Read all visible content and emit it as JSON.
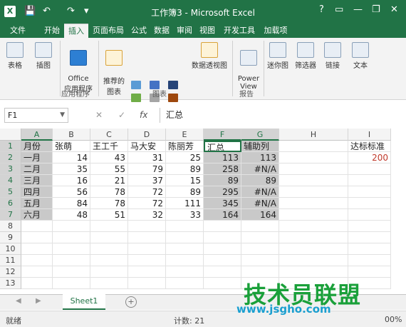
{
  "window": {
    "title": "工作簿3 - Microsoft Excel",
    "help": "?",
    "minimize": "—",
    "restore": "❐",
    "close": "✕",
    "ribbon_opts": "▭"
  },
  "quick_access": {
    "save": "💾",
    "undo": "↶",
    "redo": "↷",
    "customize": "▾"
  },
  "tabs": {
    "file": "文件",
    "items": [
      "开始",
      "插入",
      "页面布局",
      "公式",
      "数据",
      "审阅",
      "视图",
      "开发工具",
      "加载项"
    ],
    "active": "插入"
  },
  "ribbon": {
    "buttons": {
      "table": "表格",
      "illustrations": "插图",
      "office_apps": "Office\n应用程序",
      "recommended_charts": "推荐的\n图表",
      "pivot_chart": "数据透视图",
      "power_view": "Power\nView",
      "sparklines": "迷你图",
      "filter": "筛选器",
      "links": "链接",
      "text": "文本"
    },
    "groups": {
      "apps": "应用程序",
      "charts": "图表",
      "reports": "报告"
    }
  },
  "formula_bar": {
    "name_box": "F1",
    "value": "汇总",
    "cancel": "✕",
    "enter": "✓",
    "fx": "fx"
  },
  "grid": {
    "columns": [
      "A",
      "B",
      "C",
      "D",
      "E",
      "F",
      "G",
      "H",
      "I"
    ],
    "rows": [
      "1",
      "2",
      "3",
      "4",
      "5",
      "6",
      "7",
      "8",
      "9",
      "10",
      "11",
      "12",
      "13"
    ],
    "data": [
      [
        "月份",
        "张萌",
        "王工千",
        "马大安",
        "陈丽芳",
        "汇总",
        "辅助列",
        "",
        "达标标准"
      ],
      [
        "一月",
        "14",
        "43",
        "31",
        "25",
        "113",
        "113",
        "",
        "200"
      ],
      [
        "二月",
        "35",
        "55",
        "79",
        "89",
        "258",
        "#N/A",
        "",
        ""
      ],
      [
        "三月",
        "16",
        "21",
        "37",
        "15",
        "89",
        "89",
        "",
        ""
      ],
      [
        "四月",
        "56",
        "78",
        "72",
        "89",
        "295",
        "#N/A",
        "",
        ""
      ],
      [
        "五月",
        "84",
        "78",
        "72",
        "111",
        "345",
        "#N/A",
        "",
        ""
      ],
      [
        "六月",
        "48",
        "51",
        "32",
        "33",
        "164",
        "164",
        "",
        ""
      ]
    ]
  },
  "sheets": {
    "active": "Sheet1",
    "add": "+"
  },
  "status": {
    "mode": "就绪",
    "count": "计数: 21",
    "zoom": "00%"
  },
  "watermark": {
    "line1": "技术员联盟",
    "line2": "www.jsgho.com"
  }
}
